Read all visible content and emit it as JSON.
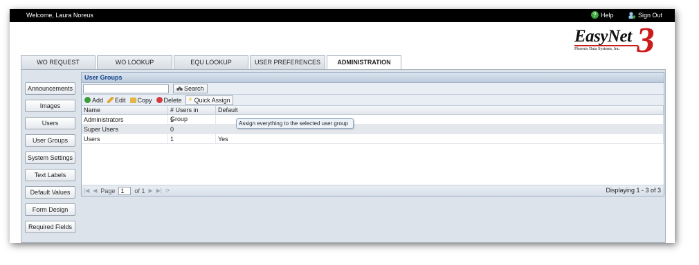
{
  "topbar": {
    "welcome": "Welcome, Laura Noreus",
    "help": "Help",
    "signout": "Sign Out"
  },
  "logo": {
    "name": "EasyNet",
    "numeral": "3",
    "subtitle": "Phoenix Data Systems, Inc."
  },
  "tabs": [
    {
      "label": "WO REQUEST"
    },
    {
      "label": "WO LOOKUP"
    },
    {
      "label": "EQU LOOKUP"
    },
    {
      "label": "USER PREFERENCES"
    },
    {
      "label": "ADMINISTRATION",
      "active": true
    }
  ],
  "sidenav": [
    {
      "label": "Announcements"
    },
    {
      "label": "Images"
    },
    {
      "label": "Users"
    },
    {
      "label": "User Groups"
    },
    {
      "label": "System Settings"
    },
    {
      "label": "Text Labels"
    },
    {
      "label": "Default Values"
    },
    {
      "label": "Form Design"
    },
    {
      "label": "Required Fields"
    }
  ],
  "panel": {
    "title": "User Groups"
  },
  "search": {
    "button": "Search",
    "value": ""
  },
  "toolbar": {
    "add": "Add",
    "edit": "Edit",
    "copy": "Copy",
    "delete": "Delete",
    "quick_assign": "Quick Assign"
  },
  "grid": {
    "columns": [
      "Name",
      "# Users in Group",
      "Default"
    ],
    "rows": [
      {
        "name": "Administrators",
        "count": "1",
        "default": ""
      },
      {
        "name": "Super Users",
        "count": "0",
        "default": ""
      },
      {
        "name": "Users",
        "count": "1",
        "default": "Yes"
      }
    ]
  },
  "pager": {
    "page_label": "Page",
    "page": "1",
    "of": "of 1",
    "displaying": "Displaying 1 - 3 of 3"
  },
  "tooltip": "Assign everything to the selected user group",
  "colors": {
    "topbar": "#000000",
    "logo_red": "#cc1b1b",
    "panel_title": "#15428b",
    "content_bg": "#dde3ea"
  }
}
